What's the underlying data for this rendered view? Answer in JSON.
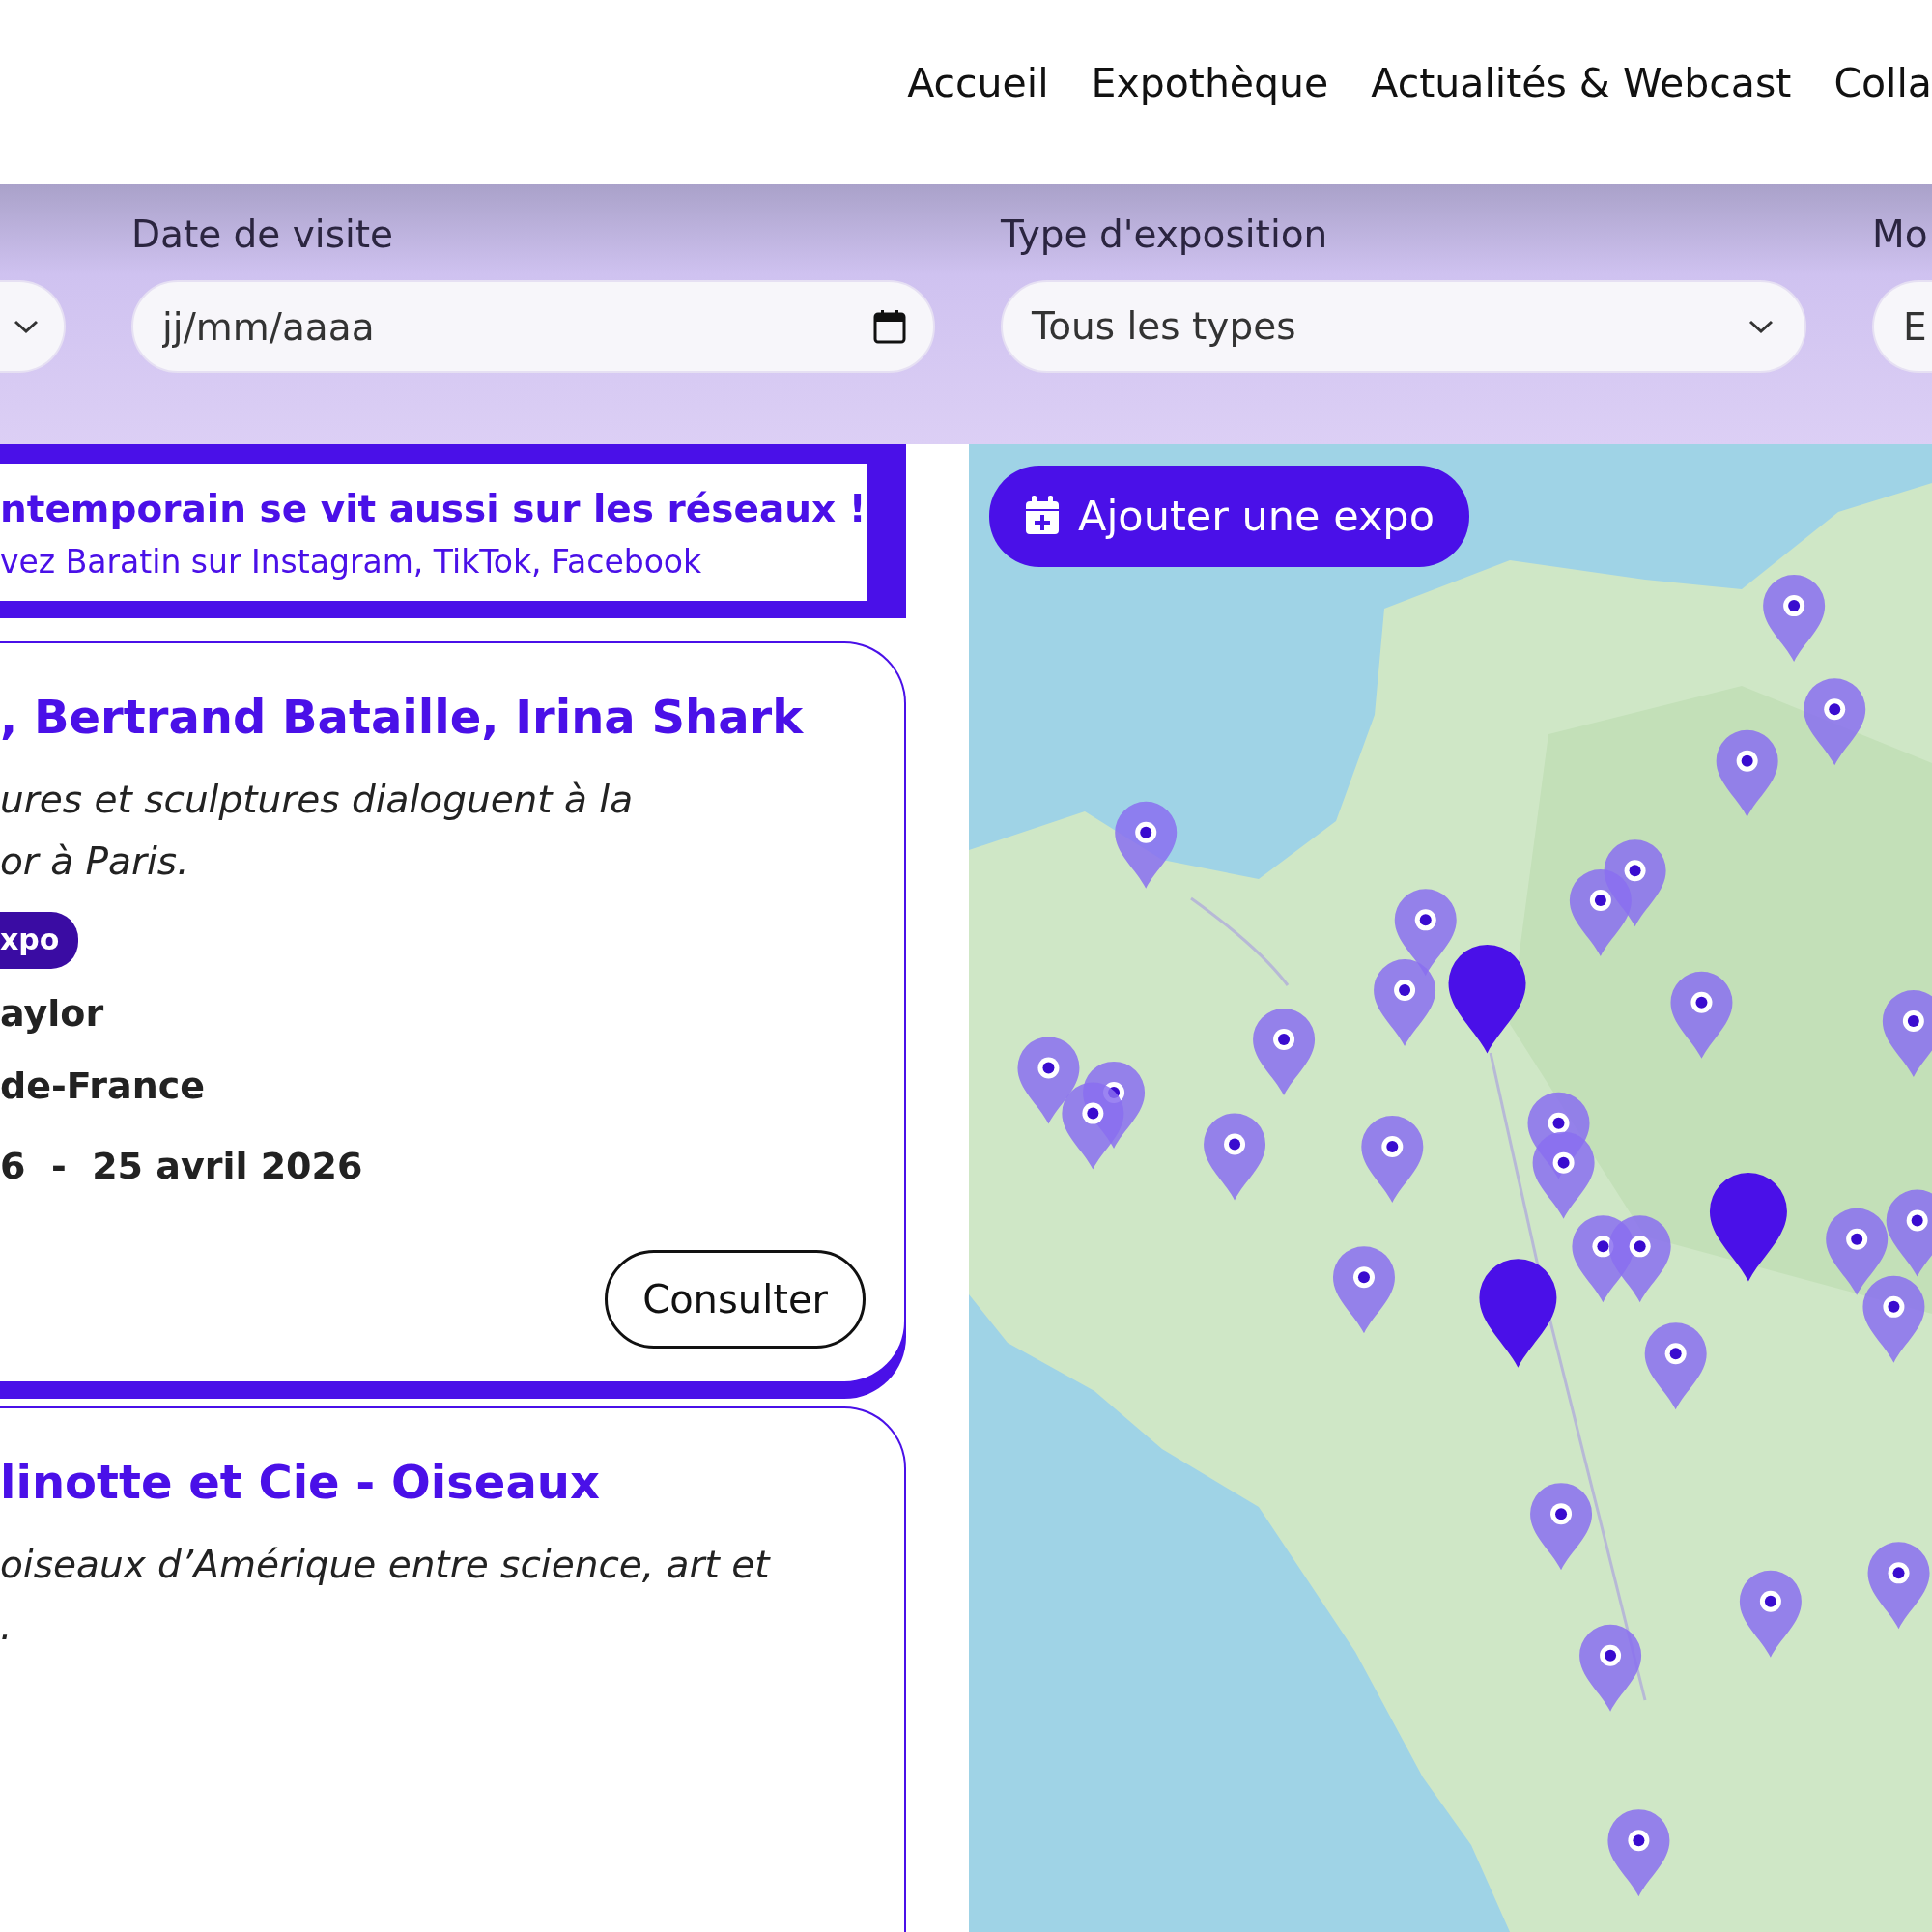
{
  "nav": {
    "items": [
      {
        "label": "Accueil"
      },
      {
        "label": "Expothèque"
      },
      {
        "label": "Actualités & Webcast"
      },
      {
        "label": "Colla"
      }
    ]
  },
  "filters": [
    {
      "kind": "select"
    },
    {
      "kind": "date",
      "label": "Date de visite",
      "placeholder": "jj/mm/aaaa"
    },
    {
      "kind": "select",
      "label": "Type d'exposition",
      "value": "Tous les types"
    },
    {
      "kind": "text",
      "label": "Mo",
      "placeholder": "E"
    }
  ],
  "banner": {
    "title": "ntemporain se vit aussi sur les réseaux !",
    "subtitle": "vez Baratin sur Instagram, TikTok, Facebook"
  },
  "cards": [
    {
      "title": ", Bertrand Bataille, Irina Shark",
      "description": [
        "ures et sculptures dialoguent à la",
        "or à Paris."
      ],
      "badge": "xpo",
      "artist": "aylor",
      "region": "de-France",
      "dates": "6  -  25 avril 2026",
      "button": "Consulter"
    },
    {
      "title": "linotte et Cie - Oiseaux",
      "description": [
        "oiseaux d’Amérique entre science, art et",
        "."
      ]
    }
  ],
  "map": {
    "button": "Ajouter une expo"
  }
}
